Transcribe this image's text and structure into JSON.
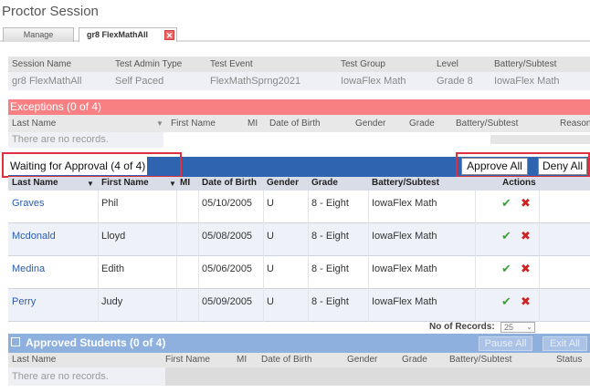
{
  "page": {
    "title": "Proctor Session"
  },
  "tabs": {
    "manage": "Manage",
    "active": "gr8 FlexMathAll",
    "close": "✕"
  },
  "session": {
    "headers": [
      "Session Name",
      "Test Admin Type",
      "Test Event",
      "Test Group",
      "Level",
      "Battery/Subtest"
    ],
    "values": [
      "gr8 FlexMathAll",
      "Self Paced",
      "FlexMathSprng2021",
      "IowaFlex Math",
      "Grade 8",
      "IowaFlex Math"
    ]
  },
  "exceptions": {
    "title": "Exceptions  (0 of 4)",
    "headers": {
      "last": "Last Name",
      "first": "First Name",
      "mi": "MI",
      "dob": "Date of Birth",
      "gender": "Gender",
      "grade": "Grade",
      "battery": "Battery/Subtest",
      "reason": "Reason"
    },
    "empty": "There are no records."
  },
  "waiting": {
    "title": "Waiting for Approval (4 of 4)",
    "approve_all": "Approve All",
    "deny_all": "Deny All",
    "headers": {
      "last": "Last Name",
      "first": "First Name",
      "mi": "MI",
      "dob": "Date of Birth",
      "gender": "Gender",
      "grade": "Grade",
      "battery": "Battery/Subtest",
      "actions": "Actions"
    },
    "rows": [
      {
        "last": "Graves",
        "first": "Phil",
        "dob": "05/10/2005",
        "gender": "U",
        "grade": "8 - Eight",
        "battery": "IowaFlex Math"
      },
      {
        "last": "Mcdonald",
        "first": "Lloyd",
        "dob": "05/08/2005",
        "gender": "U",
        "grade": "8 - Eight",
        "battery": "IowaFlex Math"
      },
      {
        "last": "Medina",
        "first": "Edith",
        "dob": "05/06/2005",
        "gender": "U",
        "grade": "8 - Eight",
        "battery": "IowaFlex Math"
      },
      {
        "last": "Perry",
        "first": "Judy",
        "dob": "05/09/2005",
        "gender": "U",
        "grade": "8 - Eight",
        "battery": "IowaFlex Math"
      }
    ],
    "records_label": "No of Records:",
    "records_value": "25"
  },
  "approved": {
    "title": "Approved Students (0 of 4)",
    "pause_all": "Pause All",
    "exit_all": "Exit All",
    "headers": {
      "last": "Last Name",
      "first": "First Name",
      "mi": "MI",
      "dob": "Date of Birth",
      "gender": "Gender",
      "grade": "Grade",
      "battery": "Battery/Subtest",
      "status": "Status"
    },
    "empty": "There are no records."
  },
  "colors": {
    "exceptions": "#f87f82",
    "waiting": "#2f64b0",
    "approved": "#8eb0de",
    "highlight": "#e03040"
  }
}
